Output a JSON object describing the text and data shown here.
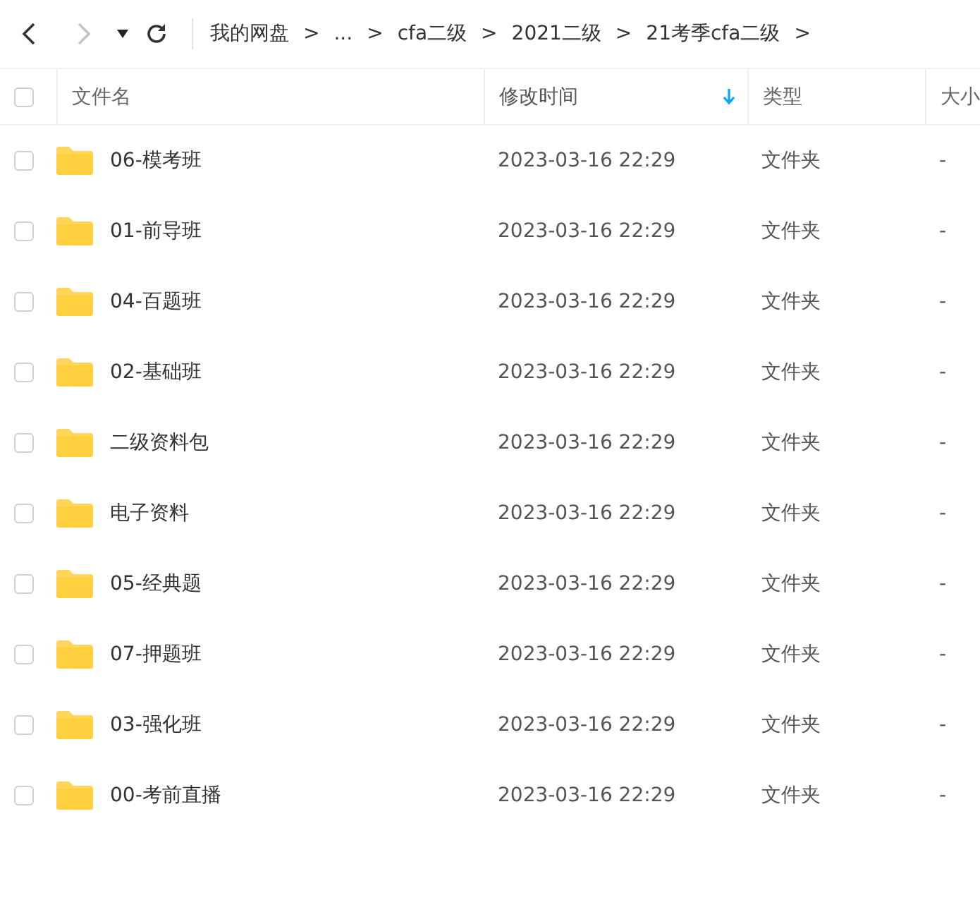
{
  "toolbar": {
    "back_disabled": false,
    "forward_disabled": true,
    "separator": ">",
    "breadcrumbs": [
      "我的网盘",
      "...",
      "cfa二级",
      "2021二级",
      "21考季cfa二级"
    ]
  },
  "table": {
    "select_all_checked": false,
    "columns": [
      {
        "label": "文件名",
        "sorted": false
      },
      {
        "label": "修改时间",
        "sorted": true
      },
      {
        "label": "类型",
        "sorted": false
      },
      {
        "label": "大小",
        "sorted": false
      }
    ],
    "rows": [
      {
        "name": "06-模考班",
        "modified": "2023-03-16 22:29",
        "type": "文件夹",
        "size": "-",
        "checked": false
      },
      {
        "name": "01-前导班",
        "modified": "2023-03-16 22:29",
        "type": "文件夹",
        "size": "-",
        "checked": false
      },
      {
        "name": "04-百题班",
        "modified": "2023-03-16 22:29",
        "type": "文件夹",
        "size": "-",
        "checked": false
      },
      {
        "name": "02-基础班",
        "modified": "2023-03-16 22:29",
        "type": "文件夹",
        "size": "-",
        "checked": false
      },
      {
        "name": "二级资料包",
        "modified": "2023-03-16 22:29",
        "type": "文件夹",
        "size": "-",
        "checked": false
      },
      {
        "name": "电子资料",
        "modified": "2023-03-16 22:29",
        "type": "文件夹",
        "size": "-",
        "checked": false
      },
      {
        "name": "05-经典题",
        "modified": "2023-03-16 22:29",
        "type": "文件夹",
        "size": "-",
        "checked": false
      },
      {
        "name": "07-押题班",
        "modified": "2023-03-16 22:29",
        "type": "文件夹",
        "size": "-",
        "checked": false
      },
      {
        "name": "03-强化班",
        "modified": "2023-03-16 22:29",
        "type": "文件夹",
        "size": "-",
        "checked": false
      },
      {
        "name": "00-考前直播",
        "modified": "2023-03-16 22:29",
        "type": "文件夹",
        "size": "-",
        "checked": false
      }
    ]
  }
}
